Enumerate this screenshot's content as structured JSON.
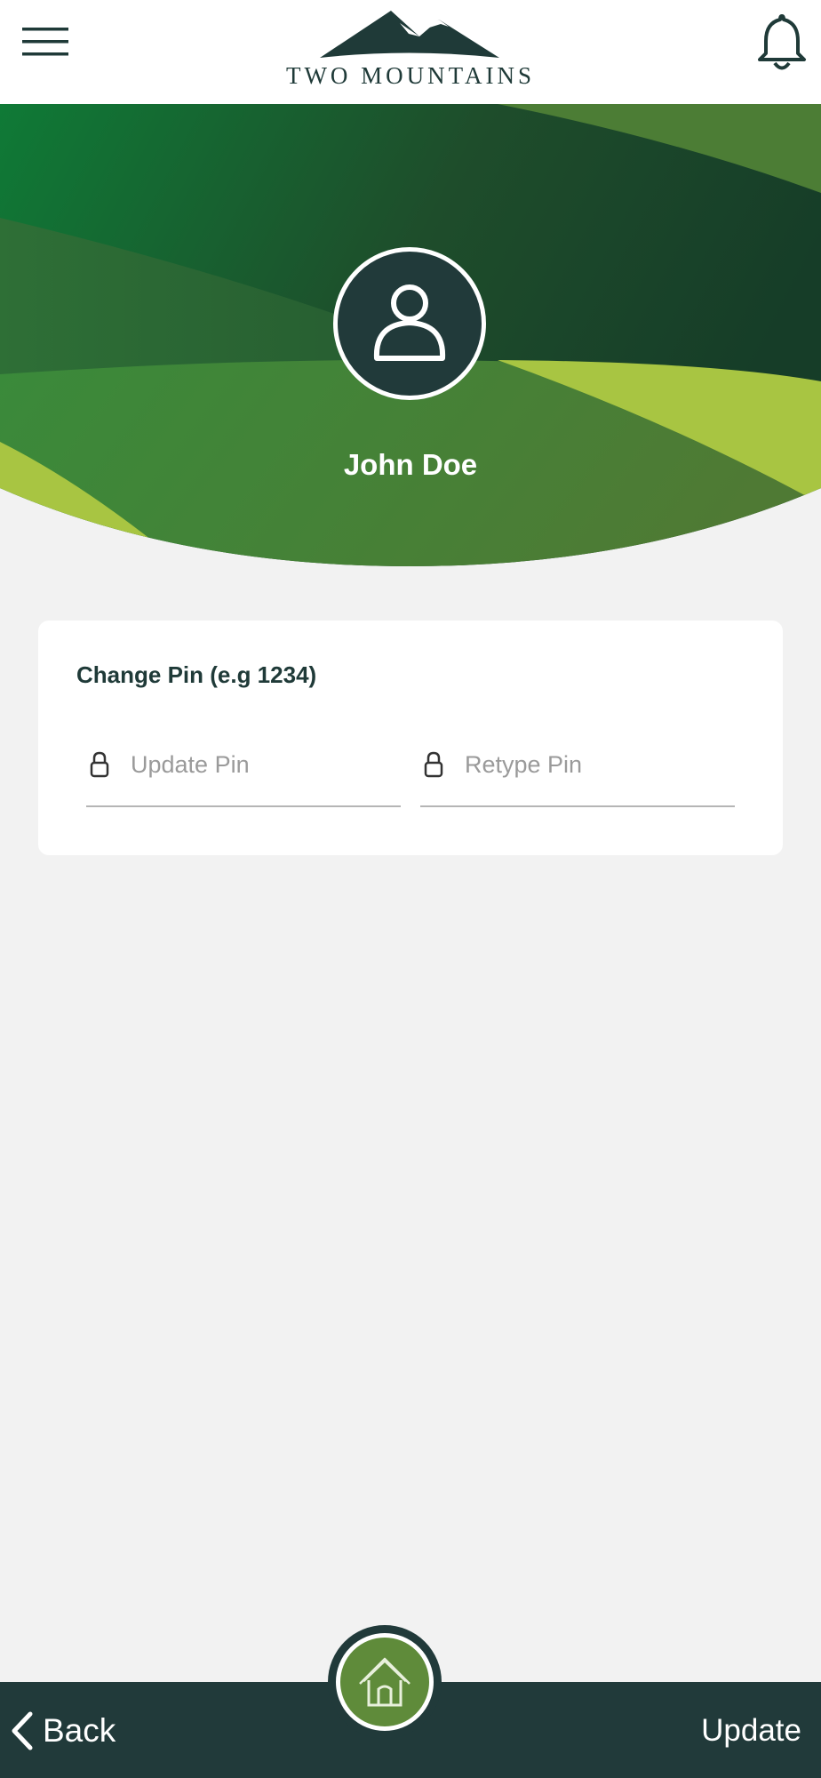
{
  "header": {
    "brand": "TWO MOUNTAINS",
    "menu_icon": "hamburger-menu-icon",
    "notification_icon": "bell-icon"
  },
  "profile": {
    "name": "John Doe",
    "avatar_icon": "user-icon"
  },
  "pin_card": {
    "title": "Change Pin (e.g 1234)",
    "update_pin": {
      "value": "",
      "placeholder": "Update Pin",
      "icon": "lock-icon"
    },
    "retype_pin": {
      "value": "",
      "placeholder": "Retype Pin",
      "icon": "lock-icon"
    }
  },
  "footer": {
    "back_label": "Back",
    "update_label": "Update",
    "home_icon": "home-icon"
  },
  "colors": {
    "primary_dark": "#213a3a",
    "accent_green": "#5f8b3a",
    "lime": "#a8c542",
    "background": "#f2f2f2"
  }
}
